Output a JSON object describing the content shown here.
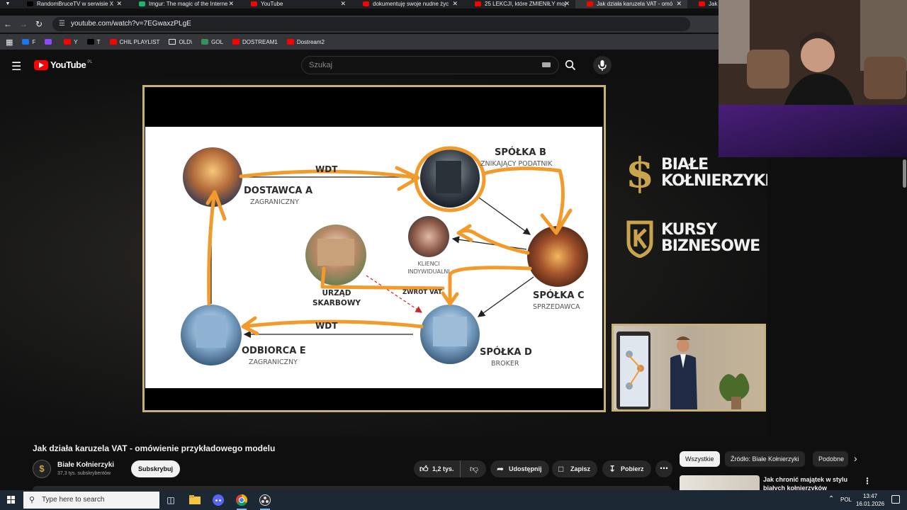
{
  "browser": {
    "tabs": [
      {
        "label": "RandomBruceTV w serwisie X",
        "favicon": "x-icon",
        "color": "#000000"
      },
      {
        "label": "Imgur: The magic of the Interne",
        "favicon": "imgur-icon",
        "color": "#1bb76e"
      },
      {
        "label": "YouTube",
        "favicon": "youtube-icon",
        "color": "#ff0000"
      },
      {
        "label": "dokumentuję swoje nudne życ",
        "favicon": "youtube-icon",
        "color": "#ff0000"
      },
      {
        "label": "25 LEKCJI, które ZMIENIŁY moj",
        "favicon": "youtube-icon",
        "color": "#ff0000"
      },
      {
        "label": "Jak działa karuzela VAT - omó",
        "favicon": "youtube-icon",
        "color": "#ff0000"
      },
      {
        "label": "Jak",
        "favicon": "youtube-icon",
        "color": "#ff0000"
      }
    ],
    "active_tab_index": 5,
    "url": "youtube.com/watch?v=7EGwaxzPLgE",
    "bookmarks": [
      {
        "label": "F",
        "icon": "facebook-icon",
        "color": "#1877f2"
      },
      {
        "label": "",
        "icon": "twitch-icon",
        "color": "#9146ff"
      },
      {
        "label": "Y",
        "icon": "youtube-icon",
        "color": "#ff0000"
      },
      {
        "label": "T",
        "icon": "x-icon",
        "color": "#000000"
      },
      {
        "label": "CHIL PLAYLIST",
        "icon": "youtube-icon",
        "color": "#ff0000"
      },
      {
        "label": "OLD\\",
        "icon": "folder-icon",
        "color": ""
      },
      {
        "label": "GOL",
        "icon": "g-icon",
        "color": "#3a8f5a"
      },
      {
        "label": "DOSTREAM1",
        "icon": "youtube-icon",
        "color": "#ff0000"
      },
      {
        "label": "Dostream2",
        "icon": "youtube-icon",
        "color": "#ff0000"
      }
    ]
  },
  "youtube": {
    "logo_text": "YouTube",
    "country_code": "PL",
    "search_placeholder": "Szukaj"
  },
  "slide": {
    "nodes": {
      "spolka_b": {
        "name": "SPÓŁKA B",
        "role": "ZNIKAJĄCY PODATNIK"
      },
      "dostawca_a": {
        "name": "DOSTAWCA A",
        "role": "ZAGRANICZNY"
      },
      "klienci": {
        "role": "KLIENCI INDYWIDUALNI"
      },
      "urzad": {
        "name": "URZĄD SKARBOWY"
      },
      "spolka_c": {
        "name": "SPÓŁKA C",
        "role": "SPRZEDAWCA"
      },
      "odbiorca_e": {
        "name": "ODBIORCA E",
        "role": "ZAGRANICZNY"
      },
      "spolka_d": {
        "name": "SPÓŁKA D",
        "role": "BROKER"
      }
    },
    "edge_labels": {
      "wdt_top": "WDT",
      "wdt_bottom": "WDT",
      "zwrot": "ZWROT VAT"
    },
    "colors": {
      "annotation": "#f39a2c",
      "frame": "#c7b07a",
      "brand_gold": "#c9a44c"
    }
  },
  "brand": {
    "line1": "BIAŁE",
    "line2": "KOŁNIERZYKI",
    "line3": "KURSY",
    "line4": "BIZNESOWE"
  },
  "video": {
    "title": "Jak działa karuzela VAT - omówienie przykładowego modelu",
    "channel_name": "Białe Kołnierzyki",
    "channel_subs": "37,3 tys. subskrybentów",
    "subscribe_label": "Subskrybuj",
    "likes_label": "1,2 tys.",
    "share_label": "Udostępnij",
    "save_label": "Zapisz",
    "download_label": "Pobierz"
  },
  "related": {
    "chips": [
      "Wszystkie",
      "Źródło: Białe Kołnierzyki",
      "Podobne"
    ],
    "first_title": "Jak chronić majątek w stylu białych kołnierzyków"
  },
  "taskbar": {
    "search_placeholder": "Type here to search",
    "language": "POL",
    "time": "13:47",
    "date": "16.01.2026"
  }
}
